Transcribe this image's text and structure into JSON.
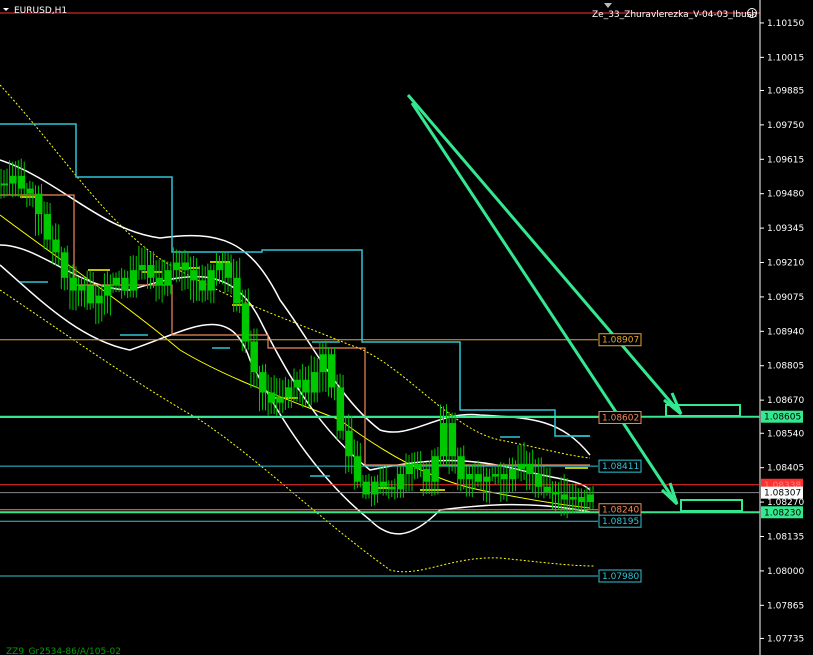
{
  "window": {
    "symbol_title": "EURUSD,H1",
    "indicator_title": "Ze_33_Zhuravlerezka_V-04-03_Ibush",
    "footer_text": "ZZ9_Gr2534-86/A/105-02"
  },
  "colors": {
    "background": "#000000",
    "axis": "#ffffff",
    "candle": "#00c800",
    "bands": "#ffffff",
    "stepline": "#2fc4d6",
    "orange": "#f08a5a",
    "yellow": "#ffff00",
    "arrow": "#34e890",
    "red": "#ff3030"
  },
  "chart_data": {
    "type": "candlestick",
    "price_axis_ticks": [
      "1.10150",
      "1.10015",
      "1.09885",
      "1.09750",
      "1.09615",
      "1.09480",
      "1.09345",
      "1.09210",
      "1.09075",
      "1.08940",
      "1.08805",
      "1.08670",
      "1.08540",
      "1.08405",
      "1.08270",
      "1.08135",
      "1.08000",
      "1.07865",
      "1.07735"
    ],
    "ylim": [
      1.0767,
      1.1024
    ],
    "level_labels": [
      {
        "price": 1.08907,
        "text": "1.08907",
        "color": "#e0a830"
      },
      {
        "price": 1.08602,
        "text": "1.08602",
        "color": "#f08a5a"
      },
      {
        "price": 1.08411,
        "text": "1.08411",
        "color": "#2fc4d6"
      },
      {
        "price": 1.0824,
        "text": "1.08240",
        "color": "#f08a5a"
      },
      {
        "price": 1.08195,
        "text": "1.08195",
        "color": "#2fc4d6"
      },
      {
        "price": 1.0798,
        "text": "1.07980",
        "color": "#2fc4d6"
      }
    ],
    "axis_markers": [
      {
        "price": 1.08605,
        "text": "1.08605",
        "fill": "#34e890",
        "color": "#000000"
      },
      {
        "price": 1.08338,
        "text": "1.08338",
        "fill": "#ff3030",
        "color": "#ff3030"
      },
      {
        "price": 1.08307,
        "text": "1.08307",
        "fill": "#ffffff",
        "color": "#000000"
      },
      {
        "price": 1.0823,
        "text": "1.08230",
        "fill": "#34e890",
        "color": "#000000"
      }
    ],
    "close_series": [
      1.0952,
      1.0955,
      1.095,
      1.0948,
      1.094,
      1.093,
      1.0925,
      1.0915,
      1.091,
      1.0912,
      1.0905,
      1.0908,
      1.0912,
      1.0915,
      1.091,
      1.0918,
      1.092,
      1.0915,
      1.0912,
      1.0918,
      1.0921,
      1.0918,
      1.0914,
      1.091,
      1.0918,
      1.0921,
      1.0915,
      1.0905,
      1.089,
      1.0878,
      1.087,
      1.0866,
      1.0868,
      1.0872,
      1.0875,
      1.087,
      1.0878,
      1.0885,
      1.0872,
      1.0855,
      1.0845,
      1.0835,
      1.083,
      1.0835,
      1.0833,
      1.0832,
      1.0838,
      1.0842,
      1.084,
      1.0835,
      1.0845,
      1.0858,
      1.0845,
      1.0836,
      1.0838,
      1.0835,
      1.0837,
      1.0838,
      1.0836,
      1.084,
      1.0842,
      1.0838,
      1.0833,
      1.0831,
      1.083,
      1.0828,
      1.0829,
      1.0827,
      1.083
    ]
  }
}
